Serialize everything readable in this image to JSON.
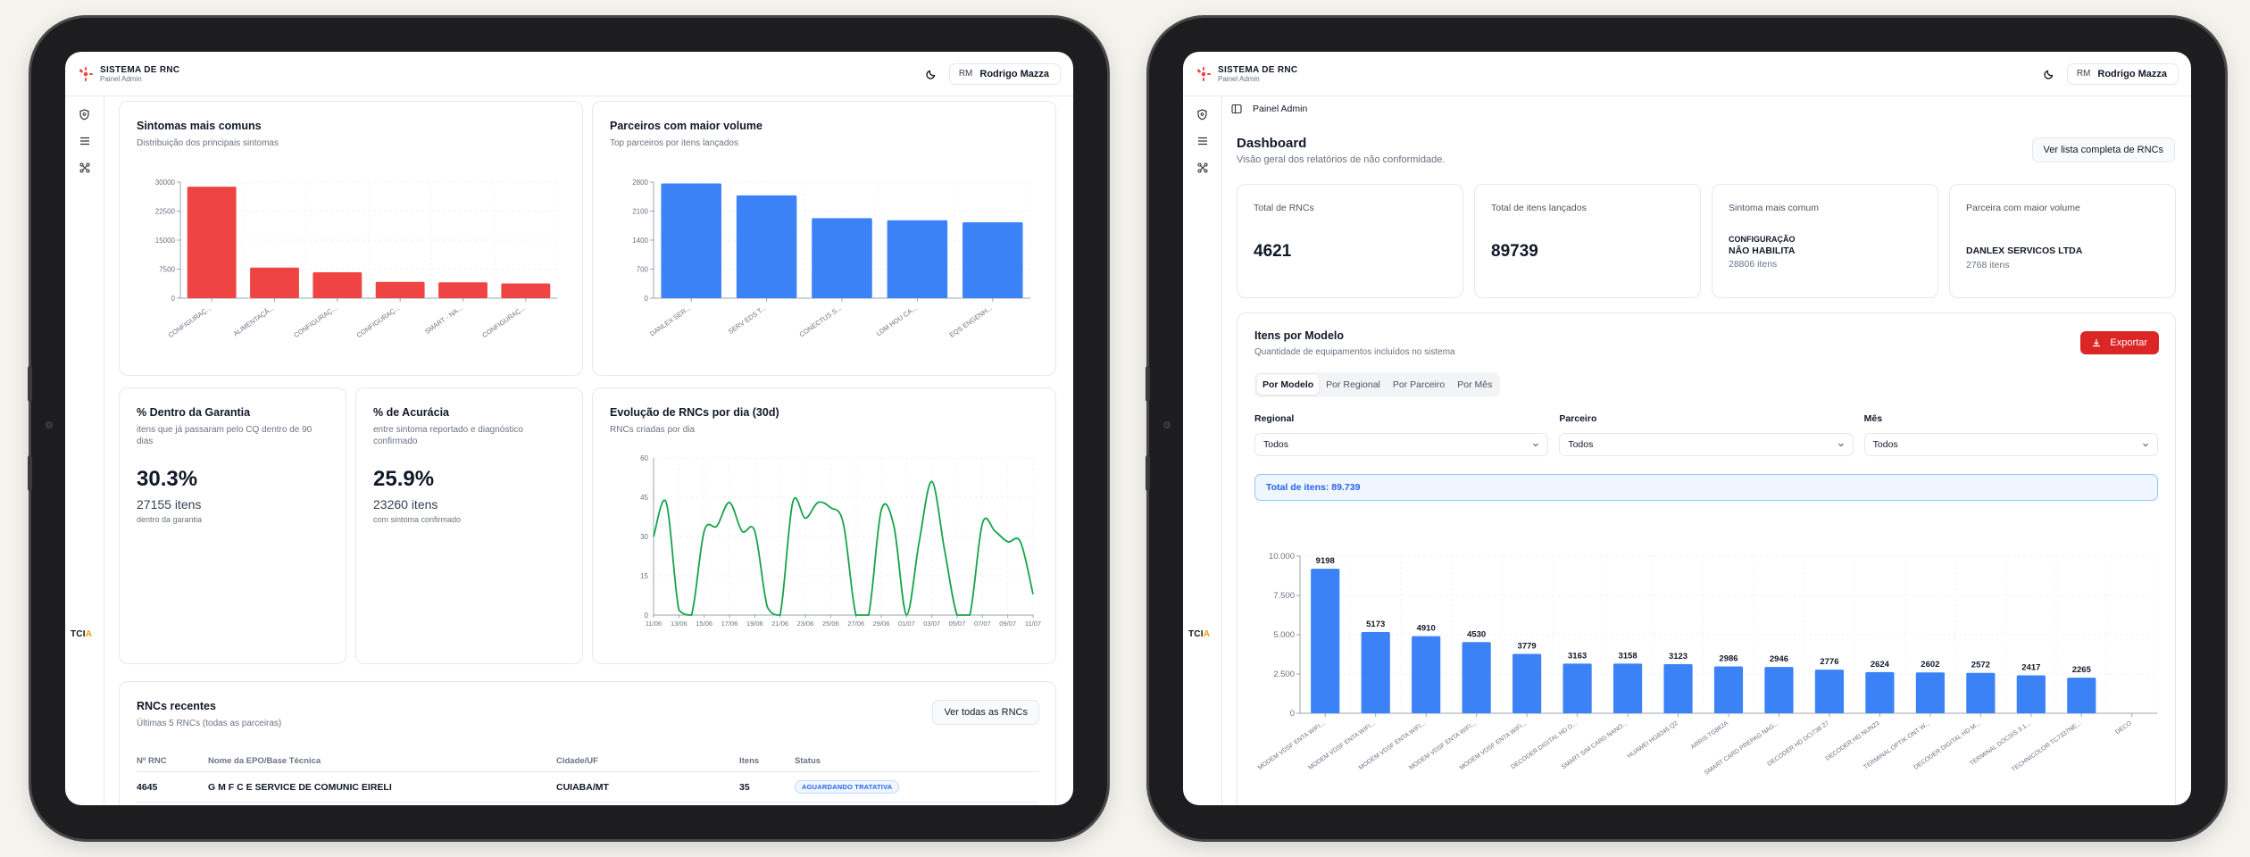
{
  "app": {
    "name": "SISTEMA DE RNC",
    "subtitle": "Painel Admin",
    "footer_logo": "TCI",
    "footer_logo_accent": "A"
  },
  "user": {
    "initials": "RM",
    "name": "Rodrigo Mazza"
  },
  "left": {
    "sintomas": {
      "title": "Sintomas mais comuns",
      "subtitle": "Distribuição dos principais sintomas",
      "chart_data": {
        "type": "bar",
        "color": "#ef4444",
        "categories": [
          "CONFIGURAÇ...",
          "ALIMENTAÇÃ...",
          "CONFIGURAÇ...",
          "CONFIGURAÇ...",
          "SMART - NA...",
          "CONFIGURAÇ..."
        ],
        "values": [
          28806,
          7900,
          6700,
          4200,
          4100,
          3800
        ],
        "yticks": [
          "0",
          "7500",
          "15000",
          "22500",
          "30000"
        ],
        "ylim": [
          0,
          30000
        ]
      }
    },
    "parceiros": {
      "title": "Parceiros com maior volume",
      "subtitle": "Top parceiros por itens lançados",
      "chart_data": {
        "type": "bar",
        "color": "#3b82f6",
        "categories": [
          "DANLEX SER...",
          "SERV EDS T...",
          "CONECTUS S...",
          "LDM HOU CA...",
          "EQS ENGENH..."
        ],
        "values": [
          2768,
          2480,
          1930,
          1880,
          1830
        ],
        "yticks": [
          "0",
          "700",
          "1400",
          "2100",
          "2800"
        ],
        "ylim": [
          0,
          2800
        ]
      }
    },
    "garantia": {
      "title": "% Dentro da Garantia",
      "subtitle": "itens que já passaram pelo CQ dentro de 90 dias",
      "value": "30.3%",
      "count": "27155 itens",
      "note": "dentro da garantia"
    },
    "acuracia": {
      "title": "% de Acurácia",
      "subtitle": "entre sintoma reportado e diagnóstico confirmado",
      "value": "25.9%",
      "count": "23260 itens",
      "note": "com sintoma confirmado"
    },
    "evolucao": {
      "title": "Evolução de RNCs por dia (30d)",
      "subtitle": "RNCs criadas por dia",
      "chart_data": {
        "type": "line",
        "color": "#16a34a",
        "x": [
          "11/06",
          "12/06",
          "13/06",
          "14/06",
          "15/06",
          "16/06",
          "17/06",
          "18/06",
          "19/06",
          "20/06",
          "21/06",
          "22/06",
          "23/06",
          "24/06",
          "25/06",
          "26/06",
          "27/06",
          "28/06",
          "29/06",
          "30/06",
          "01/07",
          "02/07",
          "03/07",
          "04/07",
          "05/07",
          "06/07",
          "07/07",
          "08/07",
          "09/07",
          "10/07",
          "11/07"
        ],
        "y": [
          30,
          43,
          2,
          0,
          32,
          34,
          43,
          32,
          32,
          3,
          0,
          43,
          37,
          43,
          41,
          35,
          0,
          0,
          40,
          34,
          0,
          28,
          51,
          25,
          0,
          0,
          35,
          32,
          28,
          28,
          8
        ],
        "xticks": [
          "11/06",
          "13/06",
          "15/06",
          "17/06",
          "19/06",
          "21/06",
          "23/06",
          "25/06",
          "27/06",
          "29/06",
          "01/07",
          "03/07",
          "05/07",
          "07/07",
          "09/07",
          "11/07"
        ],
        "yticks": [
          "0",
          "15",
          "30",
          "45",
          "60"
        ],
        "ylim": [
          0,
          60
        ]
      }
    },
    "recent": {
      "title": "RNCs recentes",
      "subtitle": "Últimas 5 RNCs (todas as parceiras)",
      "button": "Ver todas as RNCs",
      "columns": [
        "Nº RNC",
        "Nome da EPO/Base Técnica",
        "Cidade/UF",
        "Itens",
        "Status"
      ],
      "rows": [
        {
          "rnc": "4645",
          "nome": "G M F C E SERVICE DE COMUNIC EIRELI",
          "cidade": "CUIABA/MT",
          "itens": "35",
          "status": "AGUARDANDO TRATATIVA"
        }
      ]
    }
  },
  "right": {
    "breadcrumb": "Painel Admin",
    "title": "Dashboard",
    "subtitle": "Visão geral dos relatórios de não conformidade.",
    "button": "Ver lista completa de RNCs",
    "kpis": [
      {
        "label": "Total de RNCs",
        "value": "4621"
      },
      {
        "label": "Total de itens lançados",
        "value": "89739"
      },
      {
        "label": "Sintoma mais comum",
        "value_small": "CONFIGURAÇÃO",
        "value_bold": "NÃO HABILITA",
        "sub": "28806 itens"
      },
      {
        "label": "Parceira com maior volume",
        "value_bold": "DANLEX SERVICOS LTDA",
        "sub": "2768 itens"
      }
    ],
    "modelo": {
      "title": "Itens por Modelo",
      "subtitle": "Quantidade de equipamentos incluídos no sistema",
      "export": "Exportar",
      "tabs": [
        "Por Modelo",
        "Por Regional",
        "Por Parceiro",
        "Por Mês"
      ],
      "filters": [
        {
          "label": "Regional",
          "value": "Todos"
        },
        {
          "label": "Parceiro",
          "value": "Todos"
        },
        {
          "label": "Mês",
          "value": "Todos"
        }
      ],
      "total": "Total de itens: 89.739",
      "chart_data": {
        "type": "bar",
        "color": "#3b82f6",
        "categories": [
          "MODEM VDSF ENTA WIFI...",
          "MODEM VDSF ENTA WIFI...",
          "MODEM VDSF ENTA WIFI...",
          "MODEM VDSF ENTA WIFI...",
          "MODEM VDSF ENTA WIFI...",
          "DECODER DIGITAL HD D...",
          "SMART SIM CARD NANO...",
          "HUAWEI HG8245 Q2",
          "ARRIS TG862A",
          "SMART CARD PREPAG NAG...",
          "DECODER HD DCI738 27",
          "DECODER HD NUN23",
          "TERMINAL OPTIK ONT W...",
          "DECODER DIGITAL HD M...",
          "TERMINAL DOCSIS 3.1...",
          "TECHNICOLOR TC7337NE...",
          "DECO"
        ],
        "values": [
          9198,
          5173,
          4910,
          4530,
          3779,
          3163,
          3158,
          3123,
          2986,
          2946,
          2776,
          2624,
          2602,
          2572,
          2417,
          2265
        ],
        "value_labels": [
          "9198",
          "5173",
          "4910",
          "4530",
          "3779",
          "3163",
          "3158",
          "3123",
          "2986",
          "2946",
          "2776",
          "2624",
          "2602",
          "2572",
          "2417",
          "2265"
        ],
        "yticks": [
          "0",
          "2.500",
          "5.000",
          "7.500",
          "10.000"
        ],
        "ylim": [
          0,
          10000
        ]
      }
    }
  }
}
